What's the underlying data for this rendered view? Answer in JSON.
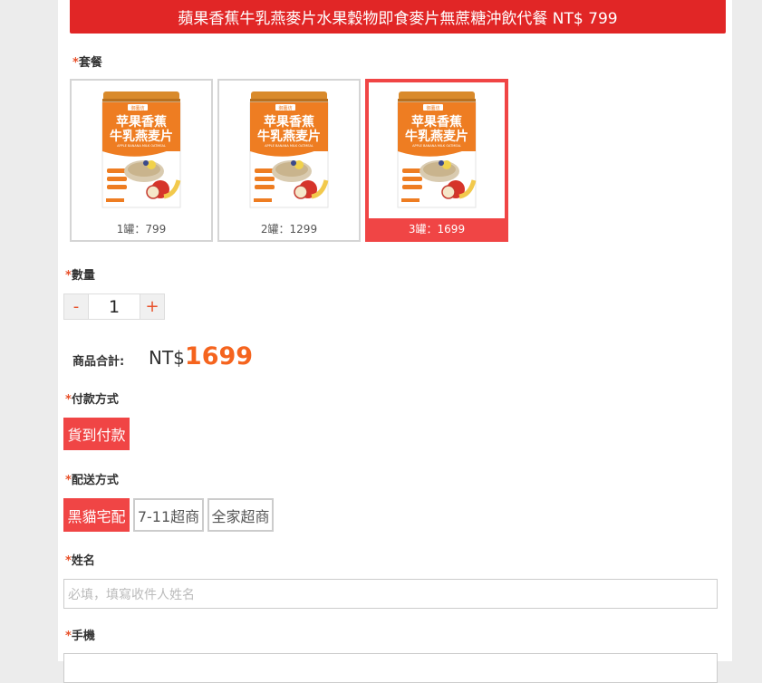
{
  "header": {
    "title": "蘋果香蕉牛乳燕麥片水果穀物即食麥片無蔗糖沖飲代餐 NT$ 799"
  },
  "package": {
    "label": "套餐",
    "required_mark": "*",
    "product": {
      "brand": "御薯坊",
      "name_line1": "苹果香蕉",
      "name_line2": "牛乳燕麦片",
      "subtitle": "APPLE BANANA MILK OATMEAL",
      "badges": [
        "高膳食纤维",
        "丰富营养",
        "营养早餐"
      ]
    },
    "options": [
      {
        "caption": "1罐：799",
        "selected": false
      },
      {
        "caption": "2罐：1299",
        "selected": false
      },
      {
        "caption": "3罐：1699",
        "selected": true
      }
    ]
  },
  "quantity": {
    "label": "數量",
    "required_mark": "*",
    "minus": "-",
    "plus": "+",
    "value": "1"
  },
  "total": {
    "label": "商品合計:",
    "currency": "NT$",
    "amount": "1699"
  },
  "payment": {
    "label": "付款方式",
    "required_mark": "*",
    "options": [
      {
        "text": "貨到付款",
        "selected": true
      }
    ]
  },
  "shipping": {
    "label": "配送方式",
    "required_mark": "*",
    "options": [
      {
        "text": "黑貓宅配",
        "selected": true
      },
      {
        "text": "7-11超商",
        "selected": false
      },
      {
        "text": "全家超商",
        "selected": false
      }
    ]
  },
  "name_field": {
    "label": "姓名",
    "required_mark": "*",
    "placeholder": "必填，填寫收件人姓名"
  },
  "phone_field": {
    "label": "手機",
    "required_mark": "*"
  },
  "colors": {
    "accent": "#e12626",
    "selected": "#f04545",
    "price": "#f5641e",
    "required": "#e8512a",
    "can_orange": "#ee7d22"
  }
}
